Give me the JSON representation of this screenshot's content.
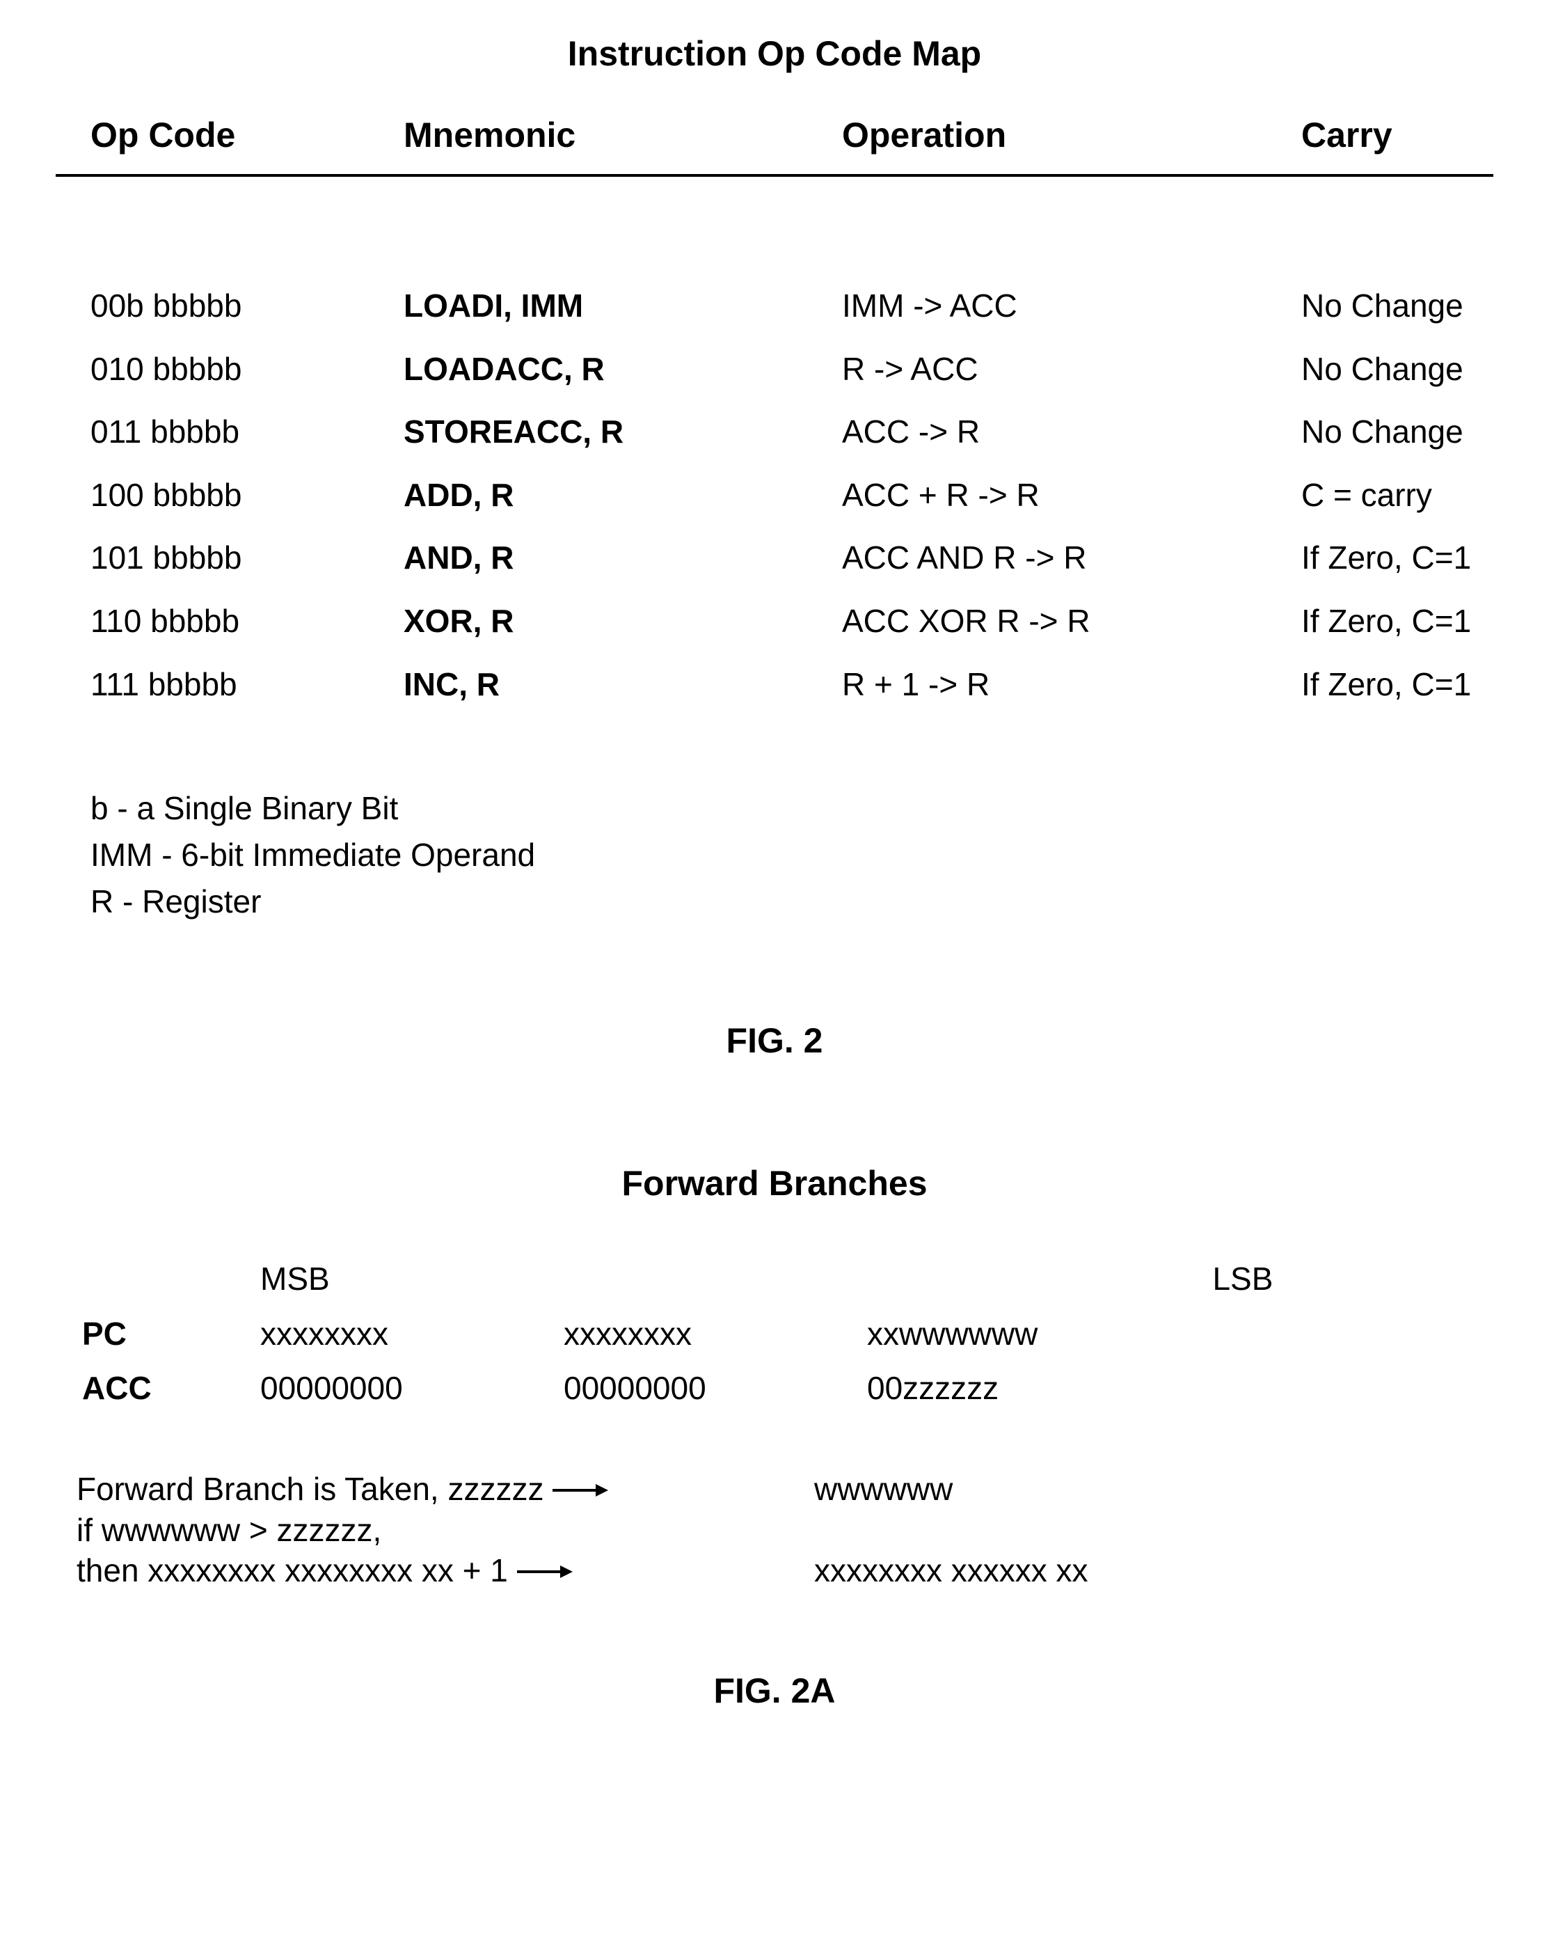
{
  "title": "Instruction Op Code Map",
  "columns": {
    "opcode": "Op Code",
    "mnemonic": "Mnemonic",
    "operation": "Operation",
    "carry": "Carry"
  },
  "rows": [
    {
      "opcode": "00b bbbbb",
      "mnemonic": "LOADI, IMM",
      "operation": "IMM -> ACC",
      "carry": "No Change"
    },
    {
      "opcode": "010 bbbbb",
      "mnemonic": "LOADACC, R",
      "operation": "R -> ACC",
      "carry": "No Change"
    },
    {
      "opcode": "011 bbbbb",
      "mnemonic": "STOREACC, R",
      "operation": "ACC -> R",
      "carry": "No Change"
    },
    {
      "opcode": "100 bbbbb",
      "mnemonic": "ADD, R",
      "operation": "ACC + R -> R",
      "carry": "C = carry"
    },
    {
      "opcode": "101 bbbbb",
      "mnemonic": "AND, R",
      "operation": "ACC AND R -> R",
      "carry": "If Zero, C=1"
    },
    {
      "opcode": "110 bbbbb",
      "mnemonic": "XOR, R",
      "operation": "ACC XOR R -> R",
      "carry": "If Zero, C=1"
    },
    {
      "opcode": "111 bbbbb",
      "mnemonic": "INC, R",
      "operation": "R + 1 -> R",
      "carry": "If Zero, C=1"
    }
  ],
  "legend": {
    "b": "b - a Single Binary Bit",
    "imm": "IMM - 6-bit Immediate Operand",
    "r": "R - Register"
  },
  "fig2_caption": "FIG. 2",
  "fb": {
    "title": "Forward Branches",
    "msb_label": "MSB",
    "lsb_label": "LSB",
    "pc_label": "PC",
    "acc_label": "ACC",
    "pc": {
      "b2": "xxxxxxxx",
      "b1": "xxxxxxxx",
      "b0": "xxwwwwww"
    },
    "acc": {
      "b2": "00000000",
      "b1": "00000000",
      "b0": "00zzzzzz"
    },
    "line1_left": "Forward Branch is Taken, zzzzzz",
    "line1_right": "wwwwww",
    "line2": "if wwwwww > zzzzzz,",
    "line3_left": "then xxxxxxxx xxxxxxxx xx + 1",
    "line3_right": "xxxxxxxx xxxxxx xx"
  },
  "fig2a_caption": "FIG. 2A"
}
